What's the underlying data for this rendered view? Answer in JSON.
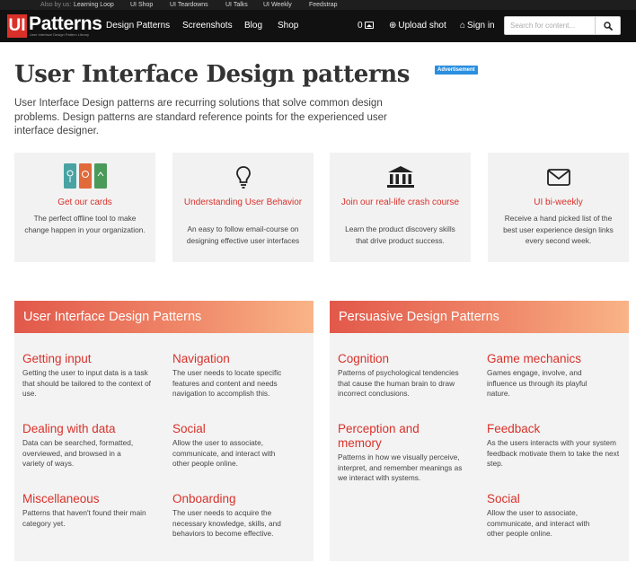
{
  "topbar": {
    "also_by": "Also by us:",
    "links": [
      "Learning Loop",
      "UI Shop",
      "UI Teardowns",
      "UI Talks",
      "UI Weekly",
      "Feedstrap"
    ]
  },
  "nav": {
    "logo_ui": "UI",
    "logo_text": "Patterns",
    "logo_tagline": "User Interface Design Pattern Library",
    "links": [
      "Design Patterns",
      "Screenshots",
      "Blog",
      "Shop"
    ],
    "shots_count": "0",
    "upload_label": "Upload shot",
    "signin_label": "Sign in",
    "search_placeholder": "Search for content..."
  },
  "hero": {
    "title": "User Interface Design patterns",
    "ad_label": "Advertisement",
    "intro": "User Interface Design patterns are recurring solutions that solve common design problems. Design patterns are standard reference points for the experienced user interface designer."
  },
  "cards": [
    {
      "icon": "cards-icon",
      "title": "Get our cards",
      "desc": "The perfect offline tool to make change happen in your organization."
    },
    {
      "icon": "lightbulb-icon",
      "title": "Understanding User Behavior",
      "desc": "An easy to follow email-course on designing effective user interfaces"
    },
    {
      "icon": "bank-icon",
      "title": "Join our real-life crash course",
      "desc": "Learn the product discovery skills that drive product success."
    },
    {
      "icon": "envelope-icon",
      "title": "UI bi-weekly",
      "desc": "Receive a hand picked list of the best user experience design links every second week."
    }
  ],
  "ui_patterns": {
    "title": "User Interface Design Patterns",
    "items": [
      {
        "title": "Getting input",
        "desc": "Getting the user to input data is a task that should be tailored to the context of use."
      },
      {
        "title": "Navigation",
        "desc": "The user needs to locate specific features and content and needs navigation to accomplish this."
      },
      {
        "title": "Dealing with data",
        "desc": "Data can be searched, formatted, overviewed, and browsed in a variety of ways."
      },
      {
        "title": "Social",
        "desc": "Allow the user to associate, communicate, and interact with other people online."
      },
      {
        "title": "Miscellaneous",
        "desc": "Patterns that haven't found their main category yet."
      },
      {
        "title": "Onboarding",
        "desc": "The user needs to acquire the necessary knowledge, skills, and behaviors to become effective."
      }
    ]
  },
  "persuasive_patterns": {
    "title": "Persuasive Design Patterns",
    "items": [
      {
        "title": "Cognition",
        "desc": "Patterns of psychological tendencies that cause the human brain to draw incorrect conclusions."
      },
      {
        "title": "Game mechanics",
        "desc": "Games engage, involve, and influence us through its playful nature."
      },
      {
        "title": "Perception and memory",
        "desc": "Patterns in how we visually perceive, interpret, and remember meanings as we interact with systems."
      },
      {
        "title": "Feedback",
        "desc": "As the users interacts with your system feedback motivate them to take the next step."
      },
      {
        "title": "Social",
        "desc": "Allow the user to associate, communicate, and interact with other people online."
      }
    ]
  },
  "colors": {
    "accent": "#d9312a",
    "nav_bg": "#111111",
    "panel_head_start": "#e2584a",
    "panel_head_end": "#f9b487",
    "card_bg": "#f2f2f2"
  }
}
